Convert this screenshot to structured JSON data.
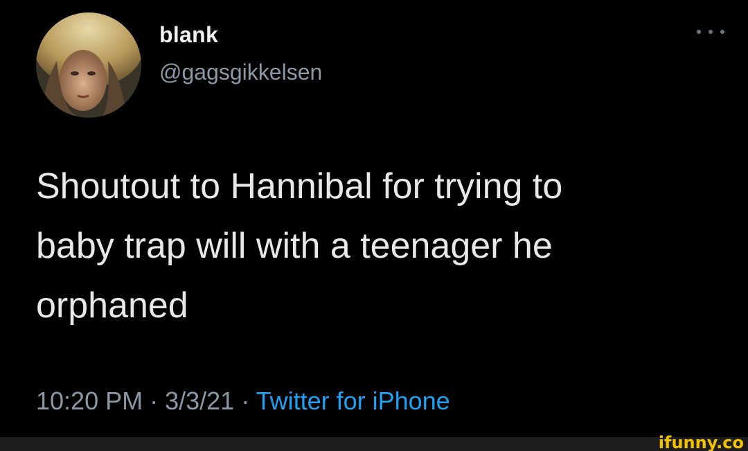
{
  "user": {
    "display_name": "blank",
    "handle": "@gagsgikkelsen"
  },
  "tweet": {
    "text": "Shoutout to Hannibal for trying to\nbaby trap will with a teenager he\norphaned",
    "time": "10:20 PM",
    "separator": "·",
    "date": "3/3/21",
    "source": "Twitter for iPhone"
  },
  "watermark": {
    "text": "ifunny.co"
  },
  "colors": {
    "background": "#000000",
    "text": "#e8e8e8",
    "muted": "#8b98a5",
    "link": "#1da1f2",
    "watermark": "#f4c300"
  },
  "icons": {
    "more": "more-horizontal-icon",
    "avatar": "user-avatar"
  }
}
